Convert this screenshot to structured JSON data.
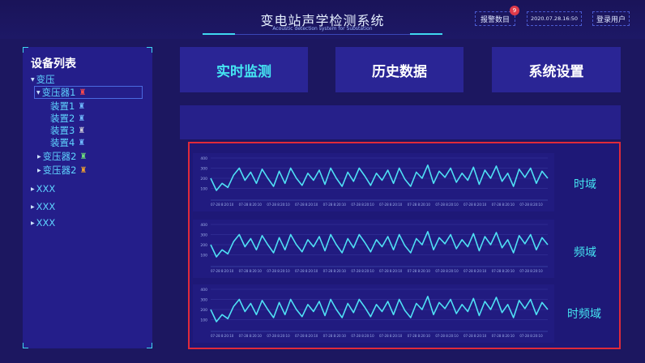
{
  "header": {
    "title": "变电站声学检测系统",
    "subtitle": "Acoustic detection system for Substation",
    "alarm_label": "报警数目",
    "alarm_count": "9",
    "datetime": "2020.07.28.16:50",
    "login_label": "登录用户"
  },
  "sidebar": {
    "title": "设备列表",
    "root": "变压",
    "transformer1": "变压器1",
    "devices": [
      "装置1",
      "装置2",
      "装置3",
      "装置4"
    ],
    "transformer2a": "变压器2",
    "transformer2b": "变压器2",
    "others": [
      "XXX",
      "XXX",
      "XXX"
    ]
  },
  "nav": {
    "realtime": "实时监测",
    "history": "历史数据",
    "settings": "系统设置"
  },
  "charts": {
    "time_label": "时域",
    "freq_label": "频域",
    "timefreq_label": "时频域",
    "y_ticks": [
      "400",
      "300",
      "200",
      "100"
    ],
    "x_tick": "07-28 8:20:10"
  },
  "colors": {
    "accent": "#45e6f2",
    "line": "#4fe0f5",
    "panel_border": "#e02a3a",
    "alarm_red": "#e03a4a"
  },
  "chart_data": [
    {
      "type": "line",
      "ylim": [
        0,
        400
      ],
      "values": [
        200,
        80,
        150,
        110,
        230,
        300,
        180,
        260,
        150,
        290,
        200,
        120,
        270,
        150,
        300,
        200,
        130,
        250,
        180,
        280,
        140,
        300,
        200,
        120,
        260,
        170,
        300,
        220,
        130,
        250,
        180,
        280,
        150,
        300,
        190,
        120,
        260,
        200,
        330,
        150,
        270,
        210,
        300,
        160,
        250,
        180,
        310,
        140,
        280,
        200,
        320,
        170,
        250,
        120,
        290,
        210,
        300,
        150,
        270,
        200
      ]
    },
    {
      "type": "line",
      "ylim": [
        0,
        400
      ],
      "values": [
        200,
        80,
        150,
        110,
        230,
        300,
        180,
        260,
        150,
        290,
        200,
        120,
        270,
        150,
        300,
        200,
        130,
        250,
        180,
        280,
        140,
        300,
        200,
        120,
        260,
        170,
        300,
        220,
        130,
        250,
        180,
        280,
        150,
        300,
        190,
        120,
        260,
        200,
        330,
        150,
        270,
        210,
        300,
        160,
        250,
        180,
        310,
        140,
        280,
        200,
        320,
        170,
        250,
        120,
        290,
        210,
        300,
        150,
        270,
        200
      ]
    },
    {
      "type": "line",
      "ylim": [
        0,
        400
      ],
      "values": [
        200,
        80,
        150,
        110,
        230,
        300,
        180,
        260,
        150,
        290,
        200,
        120,
        270,
        150,
        300,
        200,
        130,
        250,
        180,
        280,
        140,
        300,
        200,
        120,
        260,
        170,
        300,
        220,
        130,
        250,
        180,
        280,
        150,
        300,
        190,
        120,
        260,
        200,
        330,
        150,
        270,
        210,
        300,
        160,
        250,
        180,
        310,
        140,
        280,
        200,
        320,
        170,
        250,
        120,
        290,
        210,
        300,
        150,
        270,
        200
      ]
    }
  ]
}
